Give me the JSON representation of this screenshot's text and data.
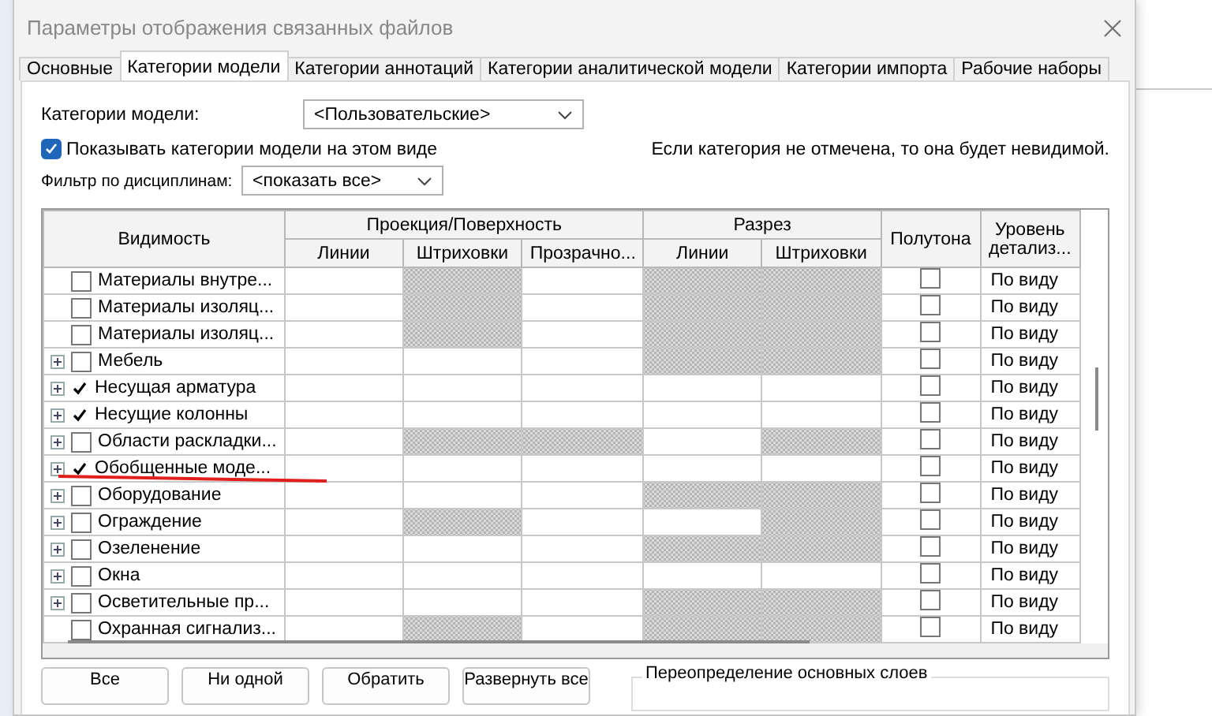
{
  "window": {
    "title": "Параметры отображения связанных файлов"
  },
  "tabs": [
    {
      "label": "Основные",
      "selected": false
    },
    {
      "label": "Категории модели",
      "selected": true
    },
    {
      "label": "Категории аннотаций",
      "selected": false
    },
    {
      "label": "Категории аналитической модели",
      "selected": false
    },
    {
      "label": "Категории импорта",
      "selected": false
    },
    {
      "label": "Рабочие наборы",
      "selected": false
    }
  ],
  "model_categories": {
    "label": "Категории модели:",
    "value": "<Пользовательские>"
  },
  "show_categories": {
    "label": "Показывать категории модели на этом виде",
    "checked": true
  },
  "hint": "Если категория не отмечена, то она будет невидимой.",
  "discipline_filter": {
    "label": "Фильтр по дисциплинам:",
    "value": "<показать все>"
  },
  "table": {
    "columns": {
      "visibility": "Видимость",
      "projection": {
        "title": "Проекция/Поверхность",
        "columns": [
          "Линии",
          "Штриховки",
          "Прозрачно..."
        ]
      },
      "section": {
        "title": "Разрез",
        "columns": [
          "Линии",
          "Штриховки"
        ]
      },
      "halftone": "Полутона",
      "detail_level": "Уровень детализ..."
    },
    "rows": [
      {
        "name": "Материалы внутре...",
        "expandable": false,
        "checked": false,
        "projection_hatched": [
          false,
          true,
          false
        ],
        "section_hatched": [
          true,
          true
        ],
        "halftone": false,
        "detail_level": "По виду"
      },
      {
        "name": "Материалы изоляц...",
        "expandable": false,
        "checked": false,
        "projection_hatched": [
          false,
          true,
          false
        ],
        "section_hatched": [
          true,
          true
        ],
        "halftone": false,
        "detail_level": "По виду"
      },
      {
        "name": "Материалы изоляц...",
        "expandable": false,
        "checked": false,
        "projection_hatched": [
          false,
          true,
          false
        ],
        "section_hatched": [
          true,
          true
        ],
        "halftone": false,
        "detail_level": "По виду"
      },
      {
        "name": "Мебель",
        "expandable": true,
        "checked": false,
        "projection_hatched": [
          false,
          false,
          false
        ],
        "section_hatched": [
          true,
          true
        ],
        "halftone": false,
        "detail_level": "По виду"
      },
      {
        "name": "Несущая арматура",
        "expandable": true,
        "checked": true,
        "projection_hatched": [
          false,
          false,
          false
        ],
        "section_hatched": [
          false,
          false
        ],
        "halftone": false,
        "detail_level": "По виду"
      },
      {
        "name": "Несущие колонны",
        "expandable": true,
        "checked": true,
        "projection_hatched": [
          false,
          false,
          false
        ],
        "section_hatched": [
          false,
          false
        ],
        "halftone": false,
        "detail_level": "По виду"
      },
      {
        "name": "Области раскладки...",
        "expandable": true,
        "checked": false,
        "projection_hatched": [
          false,
          true,
          true
        ],
        "section_hatched": [
          false,
          true
        ],
        "halftone": false,
        "detail_level": "По виду"
      },
      {
        "name": "Обобщенные моде...",
        "underlined": true,
        "expandable": true,
        "checked": true,
        "projection_hatched": [
          false,
          false,
          false
        ],
        "section_hatched": [
          false,
          false
        ],
        "halftone": false,
        "detail_level": "По виду"
      },
      {
        "name": "Оборудование",
        "expandable": true,
        "checked": false,
        "projection_hatched": [
          false,
          false,
          false
        ],
        "section_hatched": [
          true,
          true
        ],
        "halftone": false,
        "detail_level": "По виду"
      },
      {
        "name": "Ограждение",
        "expandable": true,
        "checked": false,
        "projection_hatched": [
          false,
          true,
          false
        ],
        "section_hatched": [
          false,
          true
        ],
        "halftone": false,
        "detail_level": "По виду"
      },
      {
        "name": "Озеленение",
        "expandable": true,
        "checked": false,
        "projection_hatched": [
          false,
          false,
          false
        ],
        "section_hatched": [
          true,
          true
        ],
        "halftone": false,
        "detail_level": "По виду"
      },
      {
        "name": "Окна",
        "expandable": true,
        "checked": false,
        "projection_hatched": [
          false,
          false,
          false
        ],
        "section_hatched": [
          false,
          false
        ],
        "halftone": false,
        "detail_level": "По виду"
      },
      {
        "name": "Осветительные пр...",
        "expandable": true,
        "checked": false,
        "projection_hatched": [
          false,
          false,
          false
        ],
        "section_hatched": [
          true,
          true
        ],
        "halftone": false,
        "detail_level": "По виду"
      },
      {
        "name": "Охранная сигнализ...",
        "expandable": false,
        "checked": false,
        "projection_hatched": [
          false,
          true,
          false
        ],
        "section_hatched": [
          true,
          true
        ],
        "halftone": false,
        "detail_level": "По виду"
      }
    ]
  },
  "annotation": {
    "kind": "underline",
    "color": "#e0201c"
  },
  "buttons": [
    "Все",
    "Ни одной",
    "Обратить",
    "Развернуть все"
  ],
  "layer_override": {
    "title": "Переопределение основных слоев"
  }
}
